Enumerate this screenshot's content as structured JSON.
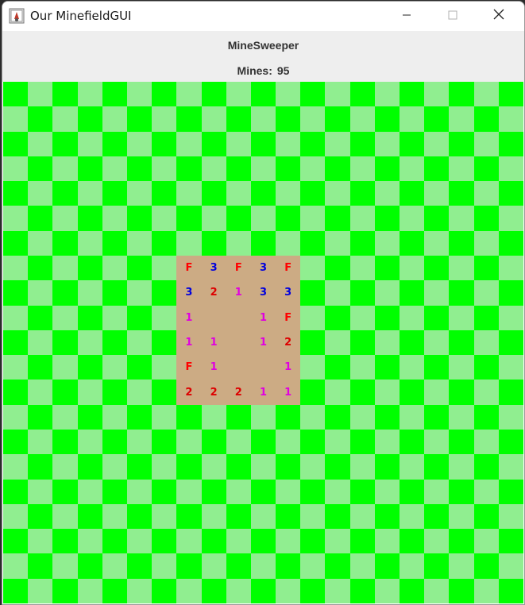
{
  "window": {
    "title": "Our MinefieldGUI"
  },
  "header": {
    "title": "MineSweeper",
    "mines_label": "Mines:",
    "mines_count": "95"
  },
  "colors": {
    "hidden_dark": "#00ff00",
    "hidden_light": "#90ee90",
    "revealed": "#ccab84",
    "flag": "#ff0000",
    "number_1": "#e000e0",
    "number_2": "#dd0000",
    "number_3": "#0000dd"
  },
  "board": {
    "rows": 21,
    "cols": 21,
    "revealed_region": {
      "row_start": 7,
      "col_start": 7
    },
    "revealed_cells": [
      [
        "F",
        "3",
        "F",
        "3",
        "F"
      ],
      [
        "3",
        "2",
        "1",
        "3",
        "3"
      ],
      [
        "1",
        "",
        "",
        "1",
        "F"
      ],
      [
        "1",
        "1",
        "",
        "1",
        "2"
      ],
      [
        "F",
        "1",
        "",
        "",
        "1"
      ],
      [
        "2",
        "2",
        "2",
        "1",
        "1"
      ]
    ]
  }
}
